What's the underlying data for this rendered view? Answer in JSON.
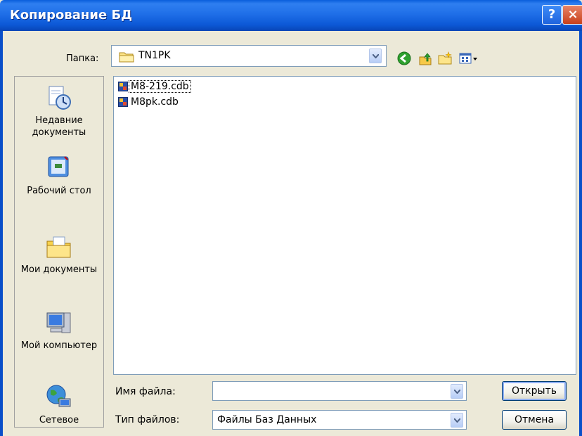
{
  "window": {
    "title": "Копирование БД",
    "help_label": "?",
    "close_label": "×"
  },
  "folder": {
    "label": "Папка:",
    "value": "TN1PK"
  },
  "places": [
    {
      "label": "Недавние документы",
      "icon": "recent-documents-icon"
    },
    {
      "label": "Рабочий стол",
      "icon": "desktop-icon"
    },
    {
      "label": "Мои документы",
      "icon": "my-documents-icon"
    },
    {
      "label": "Мой компьютер",
      "icon": "my-computer-icon"
    },
    {
      "label": "Сетевое",
      "icon": "network-icon"
    }
  ],
  "files": [
    {
      "name": "M8-219.cdb",
      "icon": "database-file-icon"
    },
    {
      "name": "M8pk.cdb",
      "icon": "database-file-icon"
    }
  ],
  "filename": {
    "label": "Имя файла:",
    "value": ""
  },
  "filetype": {
    "label": "Тип файлов:",
    "value": "Файлы Баз Данных"
  },
  "buttons": {
    "open": "Открыть",
    "cancel": "Отмена"
  },
  "colors": {
    "titlebar": "#0c58d6",
    "dialog_bg": "#ece9d8",
    "field_border": "#7f9db9"
  }
}
